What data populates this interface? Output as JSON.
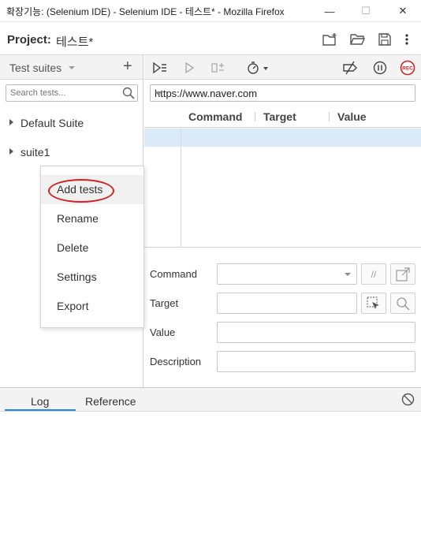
{
  "window": {
    "title": "확장기능: (Selenium IDE) - Selenium IDE - 테스트* - Mozilla Firefox",
    "controls": {
      "minimize": "—",
      "maximize": "☐",
      "close": "✕"
    }
  },
  "project": {
    "label": "Project:",
    "name": "테스트*",
    "icons": [
      "new-project-icon",
      "open-folder-icon",
      "save-icon",
      "more-vert-icon"
    ]
  },
  "sidebar": {
    "header": "Test suites",
    "add": "+",
    "search_placeholder": "Search tests...",
    "suites": [
      {
        "label": "Default Suite"
      },
      {
        "label": "suite1"
      }
    ]
  },
  "context_menu": {
    "items": [
      {
        "label": "Add tests"
      },
      {
        "label": "Rename"
      },
      {
        "label": "Delete"
      },
      {
        "label": "Settings"
      },
      {
        "label": "Export"
      }
    ],
    "highlight_color": "#d42020"
  },
  "toolbar": {
    "icons": [
      "run-all-icon",
      "run-current-icon",
      "step-over-icon",
      "speed-icon",
      "disable-breakpoints-icon",
      "pause-icon",
      "record-icon"
    ],
    "record_label": "REC"
  },
  "editor": {
    "base_url": "https://www.naver.com",
    "columns": [
      "Command",
      "Target",
      "Value"
    ],
    "form": {
      "command_label": "Command",
      "target_label": "Target",
      "value_label": "Value",
      "description_label": "Description",
      "comment_btn": "//"
    }
  },
  "bottom": {
    "tabs": [
      {
        "label": "Log"
      },
      {
        "label": "Reference"
      }
    ],
    "accent": "#1e88e5"
  }
}
